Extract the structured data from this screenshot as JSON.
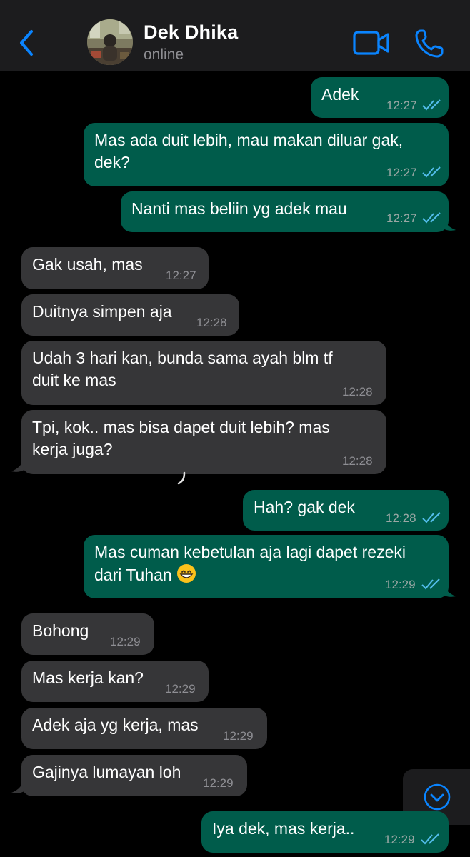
{
  "header": {
    "contact_name": "Dek Dhika",
    "status": "online",
    "back_icon": "chevron-left-icon",
    "video_icon": "video-camera-icon",
    "call_icon": "phone-icon",
    "accent_color": "#0a84ff"
  },
  "colors": {
    "background": "#000000",
    "outgoing_bubble": "#005c4b",
    "incoming_bubble": "#363638",
    "read_ticks": "#53bdeb"
  },
  "messages": [
    {
      "direction": "out",
      "line1": "Adek",
      "line2": "",
      "time": "12:27",
      "read": true
    },
    {
      "direction": "out",
      "line1": "Mas ada duit lebih, mau makan diluar gak,",
      "line2": "dek?",
      "time": "12:27",
      "read": true
    },
    {
      "direction": "out",
      "line1": "Nanti mas beliin yg adek mau",
      "line2": "",
      "time": "12:27",
      "read": true
    },
    {
      "direction": "in",
      "line1": "Gak usah, mas",
      "line2": "",
      "time": "12:27"
    },
    {
      "direction": "in",
      "line1": "Duitnya simpen aja",
      "line2": "",
      "time": "12:28"
    },
    {
      "direction": "in",
      "line1": "Udah 3 hari kan, bunda sama ayah blm tf",
      "line2": "duit ke mas",
      "time": "12:28"
    },
    {
      "direction": "in",
      "line1": "Tpi, kok.. mas bisa dapet duit lebih? mas",
      "line2": "kerja juga?",
      "time": "12:28"
    },
    {
      "direction": "out",
      "line1": "Hah? gak dek",
      "line2": "",
      "time": "12:28",
      "read": true
    },
    {
      "direction": "out",
      "line1": "Mas cuman kebetulan aja lagi dapet rezeki",
      "line2": "dari Tuhan",
      "emoji": "grinning-face-icon",
      "time": "12:29",
      "read": true
    },
    {
      "direction": "in",
      "line1": "Bohong",
      "line2": "",
      "time": "12:29"
    },
    {
      "direction": "in",
      "line1": "Mas kerja kan?",
      "line2": "",
      "time": "12:29"
    },
    {
      "direction": "in",
      "line1": "Adek aja yg kerja, mas",
      "line2": "",
      "time": "12:29"
    },
    {
      "direction": "in",
      "line1": "Gajinya lumayan loh",
      "line2": "",
      "time": "12:29"
    },
    {
      "direction": "out",
      "line1": "Iya dek, mas kerja..",
      "line2": "",
      "time": "12:29",
      "read": true
    }
  ],
  "scroll_button": {
    "icon": "chevron-down-circle-icon"
  }
}
